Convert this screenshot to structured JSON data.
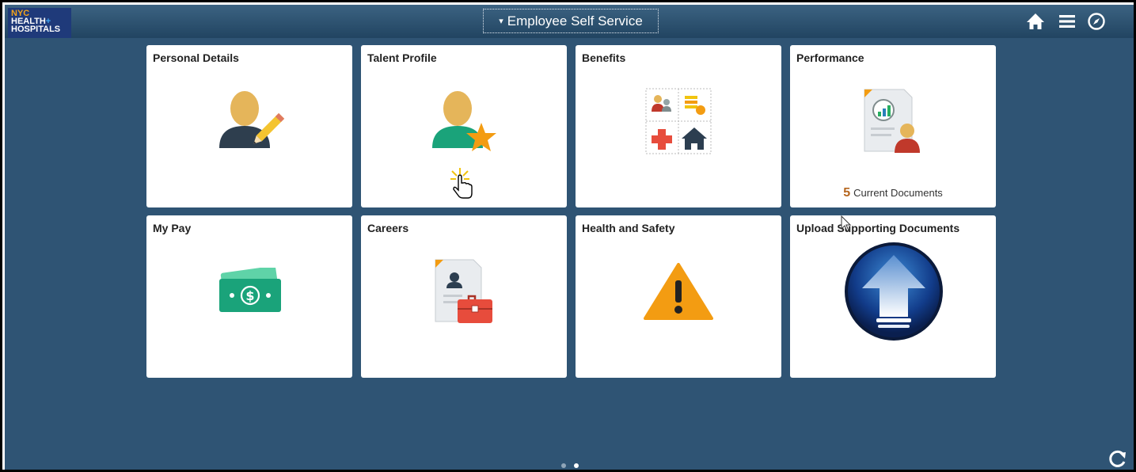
{
  "header": {
    "logo": {
      "line1": "NYC",
      "line2": "HEALTH",
      "line2_plus": "+",
      "line3": "HOSPITALS"
    },
    "title": "Employee Self Service",
    "title_caret": "▾",
    "icons": [
      "home-icon",
      "menu-icon",
      "navigator-icon"
    ]
  },
  "tiles": [
    {
      "title": "Personal Details",
      "icon": "person-edit-icon"
    },
    {
      "title": "Talent Profile",
      "icon": "person-star-icon"
    },
    {
      "title": "Benefits",
      "icon": "benefits-grid-icon"
    },
    {
      "title": "Performance",
      "icon": "performance-document-icon",
      "count": "5",
      "count_label": "Current Documents"
    },
    {
      "title": "My Pay",
      "icon": "money-icon"
    },
    {
      "title": "Careers",
      "icon": "careers-briefcase-icon"
    },
    {
      "title": "Health and Safety",
      "icon": "warning-icon"
    },
    {
      "title": "Upload Supporting Documents",
      "icon": "upload-arrow-icon"
    }
  ],
  "pagination": {
    "pages": 2,
    "current": 2
  },
  "footer": {
    "icon": "refresh-icon"
  },
  "colors": {
    "background": "#2f5474",
    "header": "#214461",
    "accent_orange": "#f39c12",
    "count_color": "#b5651d"
  }
}
